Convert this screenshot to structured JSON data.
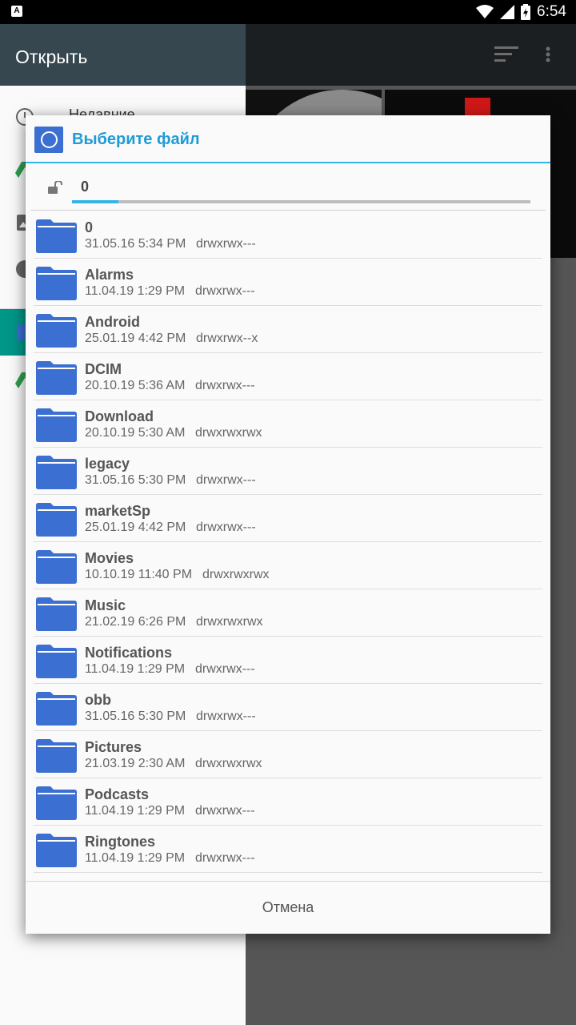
{
  "status_bar": {
    "left_icon": "A",
    "time": "6:54",
    "icons": [
      "wifi-icon",
      "signal-icon",
      "battery-charging-icon"
    ]
  },
  "drawer": {
    "title": "Открыть",
    "items": [
      {
        "label": "Недавние",
        "icon": "clock-icon"
      },
      {
        "label": "",
        "icon": "drive-icon"
      },
      {
        "label": "",
        "icon": "image-icon"
      },
      {
        "label": "",
        "icon": "download-icon"
      },
      {
        "label": "",
        "icon": "app-icon"
      },
      {
        "label": "",
        "icon": "drive-icon"
      }
    ]
  },
  "dialog": {
    "title": "Выберите файл",
    "path": "0",
    "cancel_label": "Отмена",
    "files": [
      {
        "name": "0",
        "date": "31.05.16 5:34 PM",
        "perms": "drwxrwx---"
      },
      {
        "name": "Alarms",
        "date": "11.04.19 1:29 PM",
        "perms": "drwxrwx---"
      },
      {
        "name": "Android",
        "date": "25.01.19 4:42 PM",
        "perms": "drwxrwx--x"
      },
      {
        "name": "DCIM",
        "date": "20.10.19 5:36 AM",
        "perms": "drwxrwx---"
      },
      {
        "name": "Download",
        "date": "20.10.19 5:30 AM",
        "perms": "drwxrwxrwx"
      },
      {
        "name": "legacy",
        "date": "31.05.16 5:30 PM",
        "perms": "drwxrwx---"
      },
      {
        "name": "marketSp",
        "date": "25.01.19 4:42 PM",
        "perms": "drwxrwx---"
      },
      {
        "name": "Movies",
        "date": "10.10.19 11:40 PM",
        "perms": "drwxrwxrwx"
      },
      {
        "name": "Music",
        "date": "21.02.19 6:26 PM",
        "perms": "drwxrwxrwx"
      },
      {
        "name": "Notifications",
        "date": "11.04.19 1:29 PM",
        "perms": "drwxrwx---"
      },
      {
        "name": "obb",
        "date": "31.05.16 5:30 PM",
        "perms": "drwxrwx---"
      },
      {
        "name": "Pictures",
        "date": "21.03.19 2:30 AM",
        "perms": "drwxrwxrwx"
      },
      {
        "name": "Podcasts",
        "date": "11.04.19 1:29 PM",
        "perms": "drwxrwx---"
      },
      {
        "name": "Ringtones",
        "date": "11.04.19 1:29 PM",
        "perms": "drwxrwx---"
      },
      {
        "name": "",
        "date": "",
        "perms": ""
      }
    ]
  },
  "colors": {
    "accent": "#33b5e5",
    "title": "#1e9bd7",
    "folder": "#3b6fd1",
    "drawer_header": "#37474f",
    "drawer_selected": "#009688"
  }
}
